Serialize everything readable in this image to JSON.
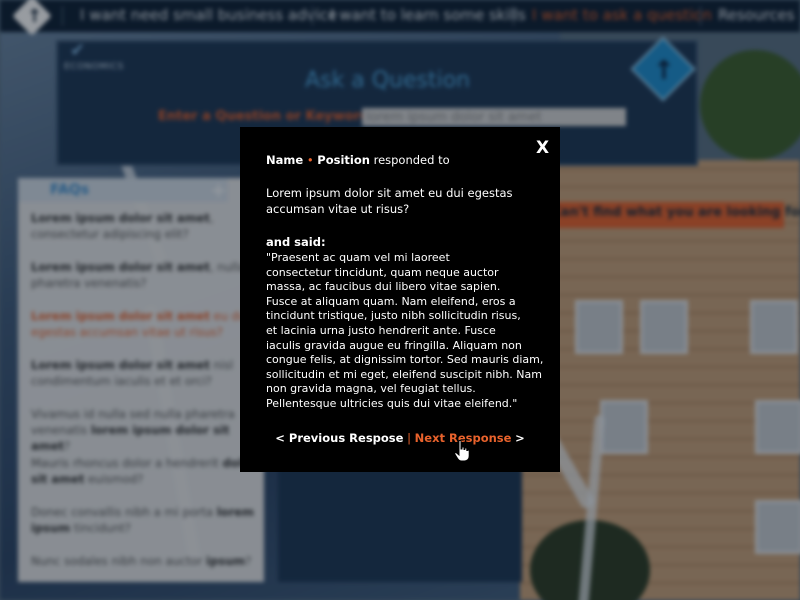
{
  "nav": {
    "items": [
      {
        "label": "I want need small business advice"
      },
      {
        "label": "I want to learn some skills"
      },
      {
        "label": "I want to ask a question"
      },
      {
        "label": "Resources"
      }
    ]
  },
  "ask": {
    "brand_label": "ECONOMICS",
    "title": "Ask a Question",
    "keyword_label": "Enter a Question or Keyword:",
    "keyword_value": "lorem ipsum dolor sit amet"
  },
  "faq": {
    "title": "FAQs",
    "items": [
      {
        "bold": "Lorem ipsum dolor sit amet",
        "rest": ", consectetur adipiscing elit?"
      },
      {
        "bold": "Lorem ipsum dolor sit amet",
        "rest": ", nulla pharetra venenatis?"
      },
      {
        "bold": "Lorem ipsum dolor sit amet",
        "rest": " eu dui egestas accumsan vitae ut risus?"
      },
      {
        "bold": "Lorem ipsum dolor sit amet",
        "rest": " nisl condimentum iaculis et et orci?"
      },
      {
        "pre": "Vivamus id nulla sed nulla pharetra venenatis ",
        "bold": "lorem ipsum dolor sit amet",
        "rest": "?"
      },
      {
        "pre": "Mauris rhoncus dolor a hendrerit ",
        "bold": "dolor sit amet",
        "rest": " euismod?"
      },
      {
        "pre": "Donec convallis nibh a mi porta ",
        "bold": "lorem ipsum",
        "rest": " tincidunt?"
      },
      {
        "pre": "Nunc sodales nibh non auctor ",
        "bold": "ipsum",
        "rest": "?"
      }
    ]
  },
  "banner": {
    "text": "Can't find what you are looking for?"
  },
  "modal": {
    "close_label": "X",
    "name": "Name",
    "dot": "•",
    "position": "Position",
    "responded_to": "responded to",
    "question": "Lorem ipsum dolor sit amet eu dui egestas accumsan vitae ut risus?",
    "said_label": "and said:",
    "answer_lines": [
      "\"Praesent ac quam vel mi laoreet",
      "consectetur tincidunt, quam neque auctor",
      "massa, ac faucibus dui libero vitae sapien.",
      "Fusce at aliquam quam. Nam eleifend, eros a",
      "tincidunt tristique, justo nibh sollicitudin risus,",
      "et lacinia urna justo hendrerit ante. Fusce",
      "iaculis gravida augue eu fringilla. Aliquam non",
      "congue felis, at dignissim tortor. Sed mauris diam,",
      "sollicitudin et mi eget, eleifend suscipit nibh. Nam",
      "non gravida magna, vel feugiat tellus.",
      "Pellentesque ultricies quis dui vitae eleifend.\""
    ],
    "prev_label": "< Previous Respose",
    "divider": "|",
    "next_label": "Next Response",
    "next_arrow": ">"
  },
  "colors": {
    "accent": "#e8622c",
    "navy": "#0d1f33",
    "link_blue": "#4ea7e0",
    "modal_bg": "#000000"
  },
  "icons": {
    "logo": "up-arrow-diamond-icon",
    "brand": "up-arrow-diamond-icon",
    "econ": "checkmark-icon",
    "faq_add": "plus-icon",
    "close": "close-icon",
    "cursor": "hand-pointer-icon"
  }
}
